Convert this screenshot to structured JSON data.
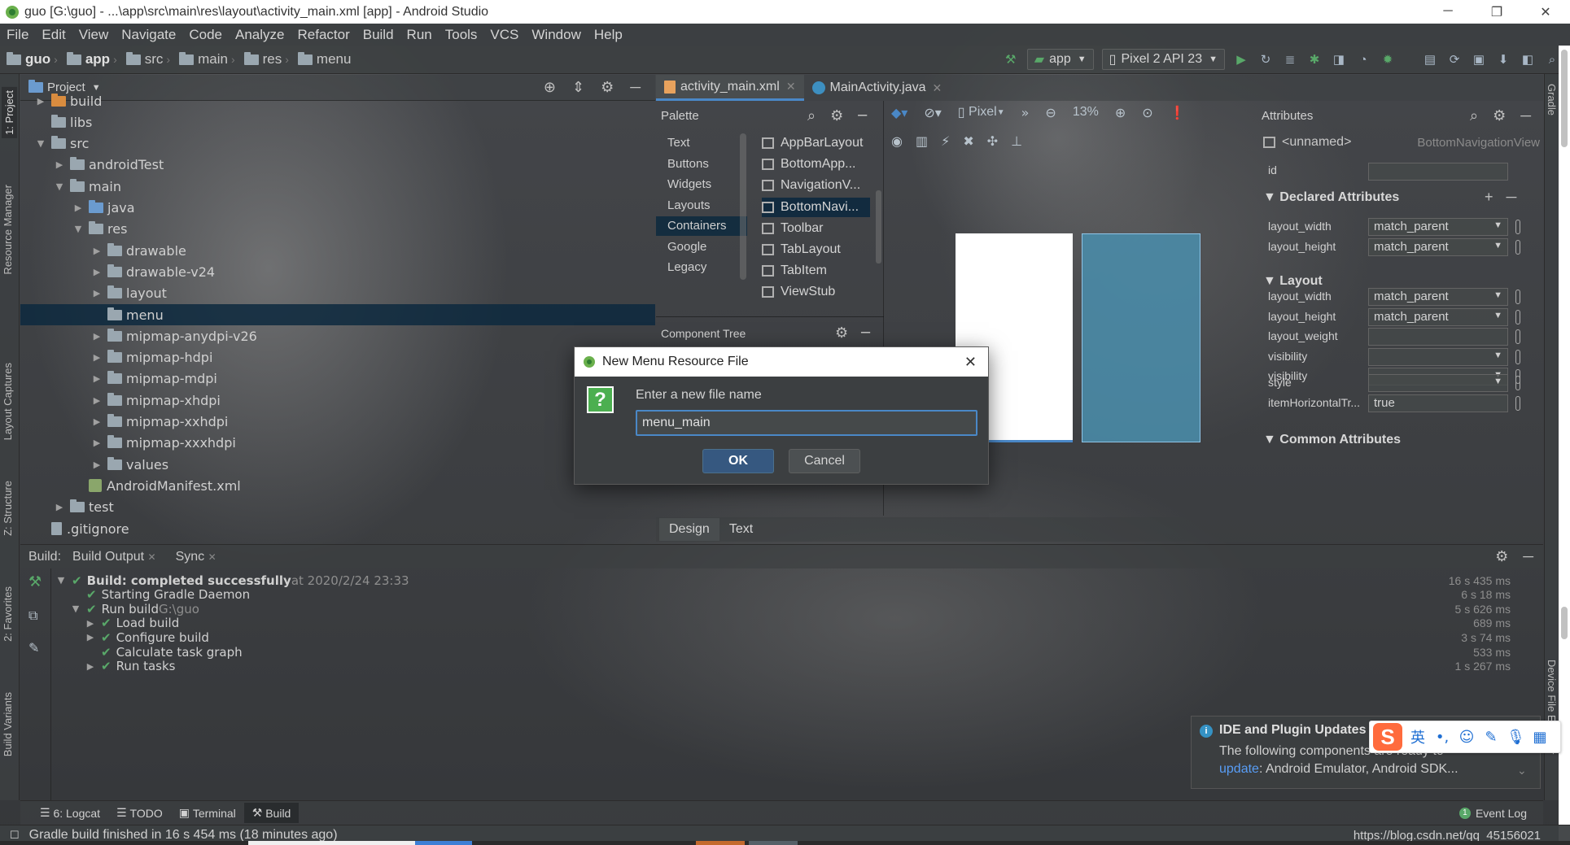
{
  "window": {
    "title": "guo [G:\\guo] - ...\\app\\src\\main\\res\\layout\\activity_main.xml [app] - Android Studio",
    "minimize": "─",
    "maximize": "❐",
    "close": "✕"
  },
  "menu": [
    "File",
    "Edit",
    "View",
    "Navigate",
    "Code",
    "Analyze",
    "Refactor",
    "Build",
    "Run",
    "Tools",
    "VCS",
    "Window",
    "Help"
  ],
  "breadcrumb": [
    "guo",
    "app",
    "src",
    "main",
    "res",
    "menu"
  ],
  "toolbar": {
    "run_config": "app",
    "device": "Pixel 2 API 23"
  },
  "left_stripe": [
    "1: Project",
    "Resource Manager",
    "Layout Captures",
    "Z: Structure",
    "2: Favorites",
    "Build Variants"
  ],
  "right_stripe": [
    "Gradle",
    "Device File Explorer"
  ],
  "project_panel": {
    "title": "Project",
    "tree": [
      {
        "label": "build",
        "depth": 2,
        "expand": "▶",
        "icon": "folder-orange"
      },
      {
        "label": "libs",
        "depth": 2,
        "expand": "",
        "icon": "folder"
      },
      {
        "label": "src",
        "depth": 2,
        "expand": "▼",
        "icon": "folder"
      },
      {
        "label": "androidTest",
        "depth": 3,
        "expand": "▶",
        "icon": "folder"
      },
      {
        "label": "main",
        "depth": 3,
        "expand": "▼",
        "icon": "folder"
      },
      {
        "label": "java",
        "depth": 4,
        "expand": "▶",
        "icon": "folder-blue"
      },
      {
        "label": "res",
        "depth": 4,
        "expand": "▼",
        "icon": "folder"
      },
      {
        "label": "drawable",
        "depth": 5,
        "expand": "▶",
        "icon": "folder"
      },
      {
        "label": "drawable-v24",
        "depth": 5,
        "expand": "▶",
        "icon": "folder"
      },
      {
        "label": "layout",
        "depth": 5,
        "expand": "▶",
        "icon": "folder"
      },
      {
        "label": "menu",
        "depth": 5,
        "expand": "",
        "icon": "folder",
        "selected": true
      },
      {
        "label": "mipmap-anydpi-v26",
        "depth": 5,
        "expand": "▶",
        "icon": "folder"
      },
      {
        "label": "mipmap-hdpi",
        "depth": 5,
        "expand": "▶",
        "icon": "folder"
      },
      {
        "label": "mipmap-mdpi",
        "depth": 5,
        "expand": "▶",
        "icon": "folder"
      },
      {
        "label": "mipmap-xhdpi",
        "depth": 5,
        "expand": "▶",
        "icon": "folder"
      },
      {
        "label": "mipmap-xxhdpi",
        "depth": 5,
        "expand": "▶",
        "icon": "folder"
      },
      {
        "label": "mipmap-xxxhdpi",
        "depth": 5,
        "expand": "▶",
        "icon": "folder"
      },
      {
        "label": "values",
        "depth": 5,
        "expand": "▶",
        "icon": "folder"
      },
      {
        "label": "AndroidManifest.xml",
        "depth": 4,
        "expand": "",
        "icon": "manifest"
      },
      {
        "label": "test",
        "depth": 3,
        "expand": "▶",
        "icon": "folder"
      },
      {
        "label": ".gitignore",
        "depth": 2,
        "expand": "",
        "icon": "file"
      }
    ]
  },
  "editor_tabs": [
    {
      "label": "activity_main.xml",
      "active": true
    },
    {
      "label": "MainActivity.java",
      "active": false
    }
  ],
  "palette": {
    "title": "Palette",
    "categories": [
      "Text",
      "Buttons",
      "Widgets",
      "Layouts",
      "Containers",
      "Google",
      "Legacy"
    ],
    "selected_category": "Containers",
    "items": [
      "AppBarLayout",
      "BottomApp...",
      "NavigationV...",
      "BottomNavi...",
      "Toolbar",
      "TabLayout",
      "TabItem",
      "ViewStub"
    ],
    "selected_item": "BottomNavi..."
  },
  "component_tree": {
    "title": "Component Tree"
  },
  "design_toolbar": {
    "device": "Pixel",
    "zoom": "13%"
  },
  "attributes": {
    "title": "Attributes",
    "component_name": "<unnamed>",
    "component_type": "BottomNavigationView",
    "id_label": "id",
    "declared_title": "Declared Attributes",
    "declared": [
      {
        "name": "layout_width",
        "value": "match_parent"
      },
      {
        "name": "layout_height",
        "value": "match_parent"
      }
    ],
    "layout_title": "Layout",
    "layout": [
      {
        "name": "layout_width",
        "value": "match_parent"
      },
      {
        "name": "layout_height",
        "value": "match_parent"
      },
      {
        "name": "layout_weight",
        "value": ""
      },
      {
        "name": "visibility",
        "value": ""
      },
      {
        "name": "visibility",
        "value": ""
      }
    ],
    "common_title": "Common Attributes",
    "common": [
      {
        "name": "style",
        "value": ""
      },
      {
        "name": "itemHorizontalTr...",
        "value": "true"
      }
    ]
  },
  "design_tabs": [
    "Design",
    "Text"
  ],
  "build_panel": {
    "label": "Build:",
    "tabs": [
      "Build Output",
      "Sync"
    ],
    "rows": [
      {
        "depth": 0,
        "expand": "▼",
        "text": "Build: completed successfully",
        "suffix": " at 2020/2/24 23:33",
        "time": "16 s 435 ms"
      },
      {
        "depth": 1,
        "expand": "",
        "text": "Starting Gradle Daemon",
        "suffix": "",
        "time": "6 s 18 ms"
      },
      {
        "depth": 1,
        "expand": "▼",
        "text": "Run build",
        "suffix": " G:\\guo",
        "time": "5 s 626 ms"
      },
      {
        "depth": 2,
        "expand": "▶",
        "text": "Load build",
        "suffix": "",
        "time": "689 ms"
      },
      {
        "depth": 2,
        "expand": "▶",
        "text": "Configure build",
        "suffix": "",
        "time": "3 s 74 ms"
      },
      {
        "depth": 2,
        "expand": "",
        "text": "Calculate task graph",
        "suffix": "",
        "time": "533 ms"
      },
      {
        "depth": 2,
        "expand": "▶",
        "text": "Run tasks",
        "suffix": "",
        "time": "1 s 267 ms"
      }
    ]
  },
  "notification": {
    "title": "IDE and Plugin Updates",
    "body": "The following components are ready to",
    "link": "update",
    "detail": ": Android Emulator, Android SDK..."
  },
  "ime": {
    "mode": "英"
  },
  "bottom_tabs": [
    "6: Logcat",
    "TODO",
    "Terminal",
    "Build"
  ],
  "event_log": "Event Log",
  "event_log_count": "1",
  "status": {
    "message": "Gradle build finished in 16 s 454 ms (18 minutes ago)",
    "url": "https://blog.csdn.net/qq_45156021"
  },
  "dialog": {
    "title": "New Menu Resource File",
    "prompt": "Enter a new file name",
    "value": "menu_main",
    "ok": "OK",
    "cancel": "Cancel"
  }
}
